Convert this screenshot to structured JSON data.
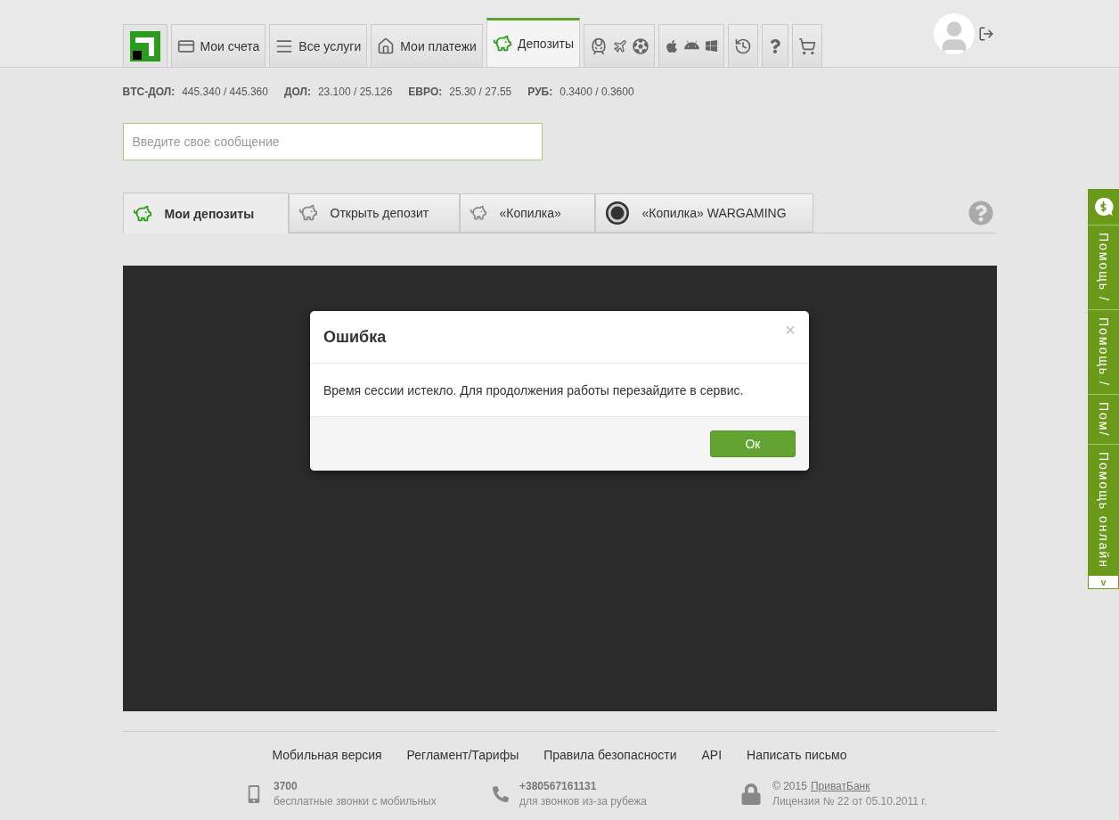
{
  "nav": {
    "tabs": [
      {
        "kind": "logo",
        "selected": false
      },
      {
        "kind": "card",
        "label": "Мои счета",
        "selected": false
      },
      {
        "kind": "list",
        "label": "Все услуги",
        "selected": false
      },
      {
        "kind": "home",
        "label": "Мои платежи",
        "selected": false
      },
      {
        "kind": "piggy",
        "label": "Депозиты",
        "selected": true
      },
      {
        "kind": "travel",
        "selected": false
      },
      {
        "kind": "platforms",
        "selected": false
      },
      {
        "kind": "history",
        "selected": false
      },
      {
        "kind": "help",
        "selected": false
      },
      {
        "kind": "cart",
        "selected": false
      }
    ]
  },
  "rates": [
    {
      "label": "BTC-ДОЛ:",
      "value": "445.340 / 445.360"
    },
    {
      "label": "ДОЛ:",
      "value": "23.100 / 25.126"
    },
    {
      "label": "ЕВРО:",
      "value": "25.30 / 27.55"
    },
    {
      "label": "РУБ:",
      "value": "0.3400 / 0.3600"
    }
  ],
  "message_field": {
    "placeholder": "Введите свое сообщение"
  },
  "deposit_tabs": [
    {
      "kind": "piggy-green",
      "label": "Мои депозиты",
      "selected": true
    },
    {
      "kind": "piggy-coins",
      "label": "Открыть депозит",
      "selected": false
    },
    {
      "kind": "piggy-grey",
      "label": "«Копилка»",
      "selected": false
    },
    {
      "kind": "wargaming",
      "label": "«Копилка» WARGAMING",
      "selected": false
    }
  ],
  "dialog": {
    "title": "Ошибка",
    "close": "×",
    "message": "Время сессии истекло. Для продолжения работы перезайдите в сервис.",
    "button": "Ок"
  },
  "footer": {
    "links": [
      "Мобильная версия",
      "Регламент/Тарифы",
      "Правила безопасности",
      "API",
      "Написать письмо"
    ],
    "contacts": [
      {
        "kind": "mobile",
        "title": "3700",
        "text": "бесплатные звонки с мобильных"
      },
      {
        "kind": "phone",
        "title": "+380567161131",
        "text": "для звонков из-за рубежа"
      },
      {
        "kind": "lock",
        "title": "© 2015",
        "link": "ПриватБанк",
        "text": "Лицензия № 22 от 05.10.2011 г."
      }
    ]
  },
  "help_bar": {
    "segments": [
      "Помощь /",
      "Помощь /",
      "Пом/",
      "Помощь онлайн"
    ],
    "toggle": "v"
  }
}
